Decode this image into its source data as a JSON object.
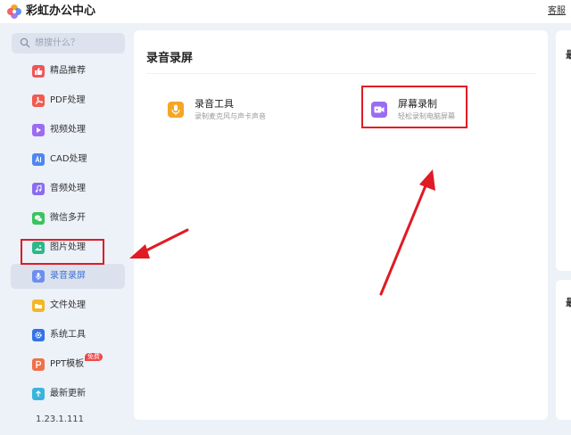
{
  "app": {
    "title": "彩虹办公中心",
    "service_link": "客服"
  },
  "search": {
    "placeholder": "想搜什么？"
  },
  "sidebar": {
    "items": [
      {
        "label": "精品推荐",
        "icon": "thumbs-up-icon",
        "color": "#f05656"
      },
      {
        "label": "PDF处理",
        "icon": "pdf-icon",
        "color": "#f05a50"
      },
      {
        "label": "视频处理",
        "icon": "video-play-icon",
        "color": "#9b6cf2"
      },
      {
        "label": "CAD处理",
        "icon": "cad-icon",
        "color": "#4f86f0"
      },
      {
        "label": "音频处理",
        "icon": "music-note-icon",
        "color": "#8b6cf0"
      },
      {
        "label": "微信多开",
        "icon": "wechat-icon",
        "color": "#38c45e"
      },
      {
        "label": "图片处理",
        "icon": "image-icon",
        "color": "#2eb88a"
      },
      {
        "label": "录音录屏",
        "icon": "microphone-icon",
        "color": "#6d8ef0"
      },
      {
        "label": "文件处理",
        "icon": "folder-icon",
        "color": "#f5b527"
      },
      {
        "label": "系统工具",
        "icon": "gear-icon",
        "color": "#3472e6"
      },
      {
        "label": "PPT模板",
        "icon": "ppt-icon",
        "color": "#f07048",
        "badge": "免费"
      },
      {
        "label": "最新更新",
        "icon": "upload-arrow-icon",
        "color": "#3ab4dd"
      }
    ],
    "active_index": 7,
    "version": "1.23.1.111"
  },
  "main": {
    "title": "录音录屏",
    "tools": [
      {
        "name": "录音工具",
        "desc": "录制麦克风与声卡声音",
        "icon": "microphone-icon",
        "color": "#f5a623"
      },
      {
        "name": "屏幕录制",
        "desc": "轻松录制电脑屏幕",
        "icon": "video-camera-icon",
        "color": "#9b6cf2"
      }
    ]
  },
  "right_panels": {
    "top_char": "最",
    "bottom_char": "最"
  },
  "colors": {
    "accent": "#3b6fd8",
    "annotation_red": "#e01b24",
    "background": "#edf1f8"
  }
}
